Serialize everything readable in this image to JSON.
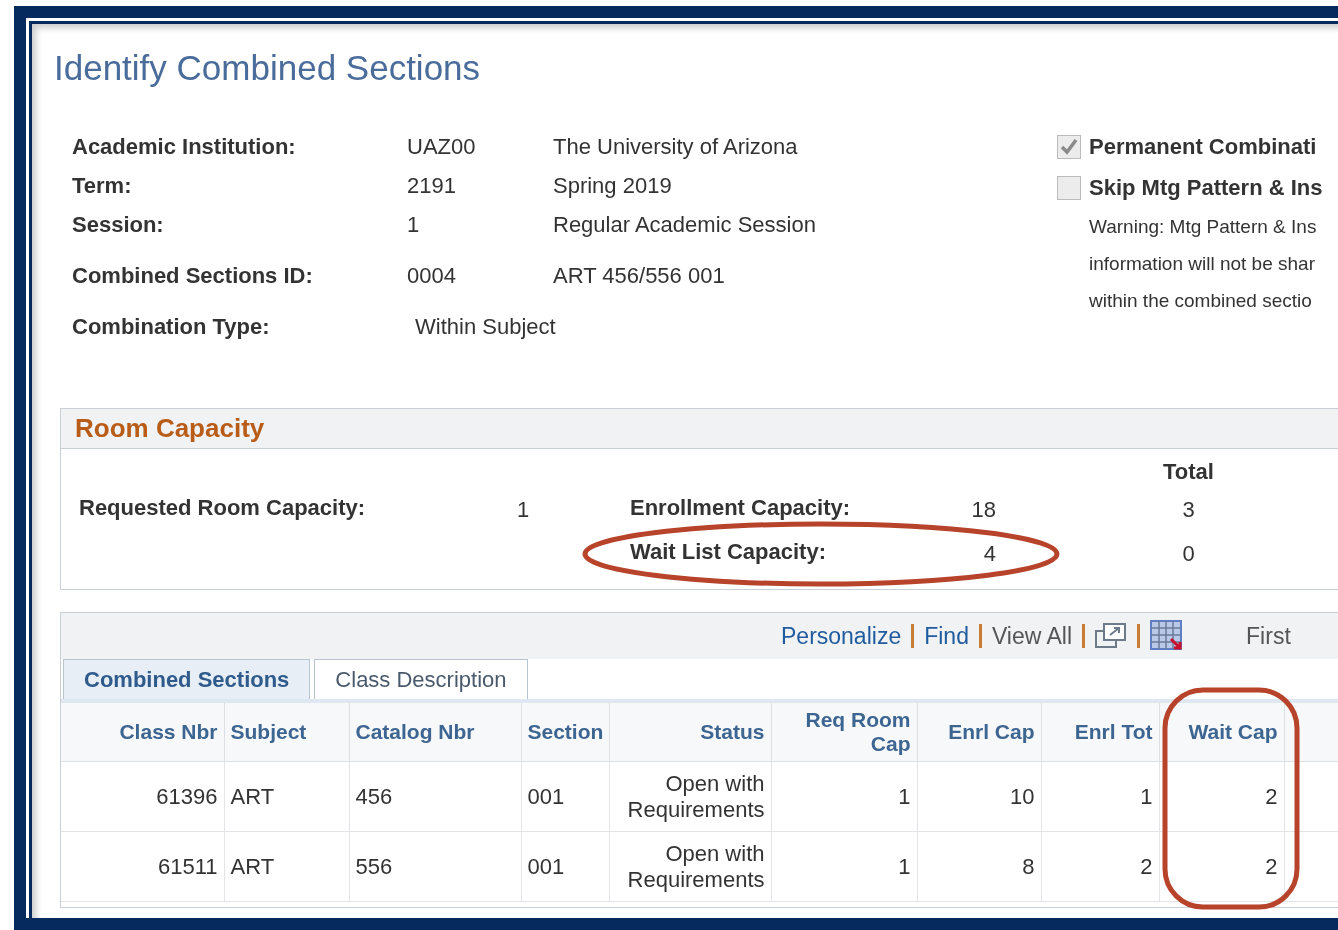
{
  "page_title": "Identify Combined Sections",
  "info": [
    {
      "label": "Academic Institution:",
      "value": "UAZ00",
      "description": "The University of Arizona"
    },
    {
      "label": "Term:",
      "value": "2191",
      "description": "Spring 2019"
    },
    {
      "label": "Session:",
      "value": "1",
      "description": "Regular Academic Session"
    },
    {
      "label": "Combined Sections ID:",
      "value": "0004",
      "description": "ART 456/556 001"
    },
    {
      "label": "Combination Type:",
      "value": "Within Subject"
    }
  ],
  "options": [
    {
      "label": "Permanent Combinati",
      "checked": true,
      "disabled": true
    },
    {
      "label": "Skip Mtg Pattern & Ins",
      "checked": false,
      "disabled": true
    }
  ],
  "warning_lines": [
    "Warning: Mtg Pattern & Ins",
    "information will not be shar",
    "within the combined sectio"
  ],
  "room_capacity": {
    "title": "Room Capacity",
    "total_heading": "Total",
    "requested_label": "Requested Room Capacity:",
    "requested_value": "1",
    "rows": [
      {
        "label": "Enrollment Capacity:",
        "value": "18",
        "total": "3"
      },
      {
        "label": "Wait List Capacity:",
        "value": "4",
        "total": "0"
      }
    ],
    "callout": {
      "kind": "ellipse"
    }
  },
  "grid": {
    "toolbar": [
      {
        "label": "Personalize",
        "kind": "link"
      },
      {
        "label": "Find",
        "kind": "link"
      },
      {
        "label": "View All",
        "kind": "text"
      },
      {
        "kind": "new-window"
      },
      {
        "kind": "download"
      }
    ],
    "pager": "First",
    "tabs": [
      {
        "label": "Combined Sections",
        "selected": true
      },
      {
        "label": "Class Description",
        "selected": false
      }
    ],
    "columns": [
      "Class Nbr",
      "Subject",
      "Catalog Nbr",
      "Section",
      "Status",
      "Req Room Cap",
      "Enrl Cap",
      "Enrl Tot",
      "Wait Cap"
    ],
    "rows": [
      [
        "61396",
        "ART",
        "456",
        "001",
        "Open with Requirements",
        "1",
        "10",
        "1",
        "2"
      ],
      [
        "61511",
        "ART",
        "556",
        "001",
        "Open with Requirements",
        "1",
        "8",
        "2",
        "2"
      ]
    ],
    "callout": {
      "kind": "column"
    }
  }
}
